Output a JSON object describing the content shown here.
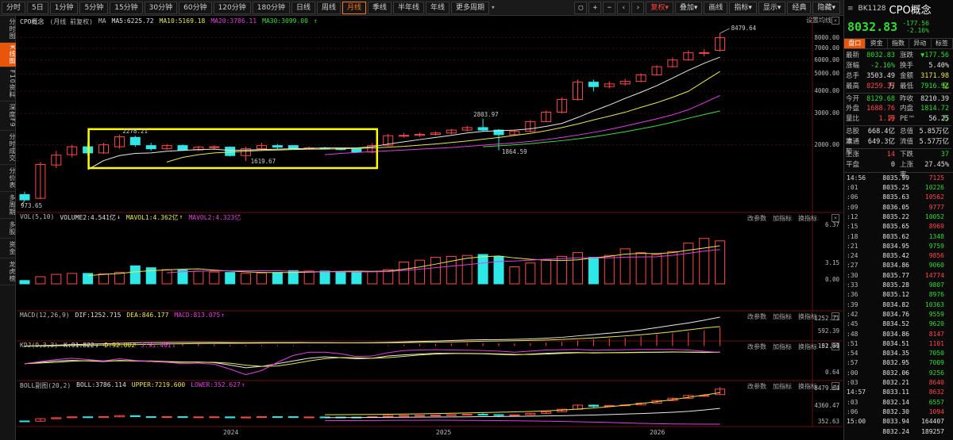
{
  "toolbar": {
    "periods": [
      {
        "label": "分时",
        "active": false
      },
      {
        "label": "5日",
        "active": false
      },
      {
        "label": "1分钟",
        "active": false
      },
      {
        "label": "5分钟",
        "active": false
      },
      {
        "label": "15分钟",
        "active": false
      },
      {
        "label": "30分钟",
        "active": false
      },
      {
        "label": "60分钟",
        "active": false
      },
      {
        "label": "120分钟",
        "active": false
      },
      {
        "label": "180分钟",
        "active": false
      },
      {
        "label": "日线",
        "active": false
      },
      {
        "label": "周线",
        "active": false
      },
      {
        "label": "月线",
        "active": true
      },
      {
        "label": "季线",
        "active": false
      },
      {
        "label": "半年线",
        "active": false
      },
      {
        "label": "年线",
        "active": false
      },
      {
        "label": "更多周期",
        "active": false
      }
    ],
    "more_arrow": "▾",
    "icons": [
      {
        "name": "window-icon",
        "glyph": "▢"
      },
      {
        "name": "zoom-in-icon",
        "glyph": "+"
      },
      {
        "name": "zoom-out-icon",
        "glyph": "−"
      },
      {
        "name": "chevron-left-icon",
        "glyph": "‹"
      },
      {
        "name": "chevron-right-icon",
        "glyph": "›"
      }
    ],
    "menus": [
      {
        "label": "复权▾",
        "red": true
      },
      {
        "label": "叠加▾",
        "red": false
      },
      {
        "label": "画线",
        "red": false
      },
      {
        "label": "指标▾",
        "red": false
      },
      {
        "label": "显示▾",
        "red": false
      },
      {
        "label": "经典",
        "red": false
      },
      {
        "label": "隐藏▾",
        "red": false
      }
    ]
  },
  "left_tabs": [
    {
      "label": "分时图",
      "active": false
    },
    {
      "label": "K线图",
      "active": true
    },
    {
      "label": "F10资料",
      "active": false
    },
    {
      "label": "深度F9",
      "active": false
    },
    {
      "label": "分时成交",
      "active": false
    },
    {
      "label": "分价表",
      "active": false
    },
    {
      "label": "多周期",
      "active": false
    },
    {
      "label": "多股",
      "active": false
    },
    {
      "label": "资金",
      "active": false
    },
    {
      "label": "龙虎榜",
      "active": false
    }
  ],
  "main": {
    "title": "CPO概念",
    "subtitle": "(月线 前复权)",
    "ma_label": "MA",
    "ma5": "MA5:6225.72",
    "ma10": "MA10:5169.18",
    "ma20": "MA20:3786.11",
    "ma30": "MA30:3099.00",
    "arrow_up": "↑",
    "settings": "设置均线",
    "y_ticks": [
      "8000.00",
      "7000.00",
      "6000.00",
      "5000.00",
      "4000.00",
      "3000.00",
      "2000.00"
    ],
    "annotations": {
      "high": "8479.64",
      "low": "973.65",
      "peak_2024": "2278.21",
      "trough_2024": "1619.67",
      "peak_2025": "2803.97",
      "trough_2025": "1864.59"
    }
  },
  "vol_panel": {
    "name": "VOL(5,10)",
    "vol": "VOLUME2:4.541亿",
    "ma1": "MAVOL1:4.362亿",
    "ma2": "MAVOL2:4.323亿",
    "down_arrow": "↓",
    "up_arrow": "↑",
    "y_ticks": [
      "6.37",
      "3.15",
      "0.00"
    ]
  },
  "macd_panel": {
    "name": "MACD(12,26,9)",
    "dif": "DIF:1252.715",
    "dea": "DEA:846.177",
    "macd": "MACD:813.075",
    "up_arrow": "↑",
    "y_ticks": [
      "1252.71",
      "592.39",
      "-51.01"
    ]
  },
  "kdj_panel": {
    "name": "KDJ(9,3,3)",
    "k": "K:91.822",
    "d": "D:92.002",
    "j": "J:91.461",
    "down_arrow": "↓",
    "y_ticks": [
      "102.99",
      "0.64"
    ]
  },
  "boll_panel": {
    "name": "BOLL副图(20,2)",
    "boll": "BOLL:3786.114",
    "upper": "UPPER:7219.600",
    "lower": "LOWER:352.627",
    "up_arrow": "↑",
    "y_ticks": [
      "8479.64",
      "4360.47",
      "352.63"
    ]
  },
  "panel_tools": [
    "改参数",
    "加指标",
    "换指标"
  ],
  "close_glyph": "×",
  "x_labels": [
    "2024",
    "2025",
    "2026"
  ],
  "quote": {
    "code": "BK1128",
    "name": "CPO概念",
    "price": "8032.83",
    "change": "-177.56",
    "change_pct": "-2.16%",
    "tabs": [
      {
        "label": "盘口",
        "active": true
      },
      {
        "label": "资金",
        "active": false
      },
      {
        "label": "指数",
        "active": false
      },
      {
        "label": "异动",
        "active": false
      },
      {
        "label": "标签",
        "active": false
      }
    ],
    "rows": [
      {
        "k": "最新",
        "v": "8032.83",
        "vc": "g",
        "k2": "涨跌",
        "v2": "▼177.56",
        "v2c": "g"
      },
      {
        "k": "涨幅",
        "v": "-2.16%",
        "vc": "g",
        "k2": "换手",
        "v2": "5.40%",
        "v2c": "w"
      },
      {
        "k": "总手",
        "v": "3503.49万",
        "vc": "w",
        "k2": "金额",
        "v2": "3171.98亿",
        "v2c": "y"
      },
      {
        "k": "最高",
        "v": "8259.37",
        "vc": "r",
        "k2": "最低",
        "v2": "7916.92",
        "v2c": "g"
      },
      {
        "k": "今开",
        "v": "8129.68",
        "vc": "g",
        "k2": "昨收",
        "v2": "8210.39",
        "v2c": "w"
      },
      {
        "k": "外盘",
        "v": "1688.76万",
        "vc": "r",
        "k2": "内盘",
        "v2": "1814.72万",
        "v2c": "g"
      },
      {
        "k": "量比",
        "v": "1.10",
        "vc": "r",
        "k2": "PE™",
        "v2": "56.25",
        "v2c": "w"
      },
      {
        "k": "总股本",
        "v": "668.4亿",
        "vc": "w",
        "k2": "总值",
        "v2": "5.85万亿",
        "v2c": "w"
      },
      {
        "k": "流通股",
        "v": "649.3亿",
        "vc": "w",
        "k2": "流值",
        "v2": "5.57万亿",
        "v2c": "w"
      },
      {
        "k": "上涨",
        "v": "14",
        "vc": "r",
        "k2": "下跌",
        "v2": "37",
        "v2c": "g"
      },
      {
        "k": "平盘",
        "v": "0",
        "vc": "w",
        "k2": "上涨率",
        "v2": "27.45%",
        "v2c": "w"
      }
    ],
    "ticks": [
      {
        "t": "14:56",
        "p": "8035.99",
        "v": "7125",
        "c": "r"
      },
      {
        "t": ":01",
        "p": "8035.25",
        "v": "10226",
        "c": "g"
      },
      {
        "t": ":06",
        "p": "8035.63",
        "v": "10562",
        "c": "r"
      },
      {
        "t": ":09",
        "p": "8036.05",
        "v": "9777",
        "c": "r"
      },
      {
        "t": ":12",
        "p": "8035.22",
        "v": "10052",
        "c": "g"
      },
      {
        "t": ":15",
        "p": "8035.65",
        "v": "8969",
        "c": "r"
      },
      {
        "t": ":18",
        "p": "8035.62",
        "v": "1348",
        "c": "g"
      },
      {
        "t": ":21",
        "p": "8034.95",
        "v": "9759",
        "c": "g"
      },
      {
        "t": ":24",
        "p": "8035.42",
        "v": "9856",
        "c": "r"
      },
      {
        "t": ":27",
        "p": "8034.86",
        "v": "9060",
        "c": "g"
      },
      {
        "t": ":30",
        "p": "8035.77",
        "v": "14774",
        "c": "r"
      },
      {
        "t": ":33",
        "p": "8035.28",
        "v": "9807",
        "c": "g"
      },
      {
        "t": ":36",
        "p": "8035.12",
        "v": "8976",
        "c": "g"
      },
      {
        "t": ":39",
        "p": "8034.82",
        "v": "10363",
        "c": "g"
      },
      {
        "t": ":42",
        "p": "8034.76",
        "v": "9559",
        "c": "g"
      },
      {
        "t": ":45",
        "p": "8034.52",
        "v": "9620",
        "c": "g"
      },
      {
        "t": ":48",
        "p": "8034.86",
        "v": "8147",
        "c": "r"
      },
      {
        "t": ":51",
        "p": "8034.51",
        "v": "1101",
        "c": "r"
      },
      {
        "t": ":54",
        "p": "8034.35",
        "v": "7050",
        "c": "g"
      },
      {
        "t": ":57",
        "p": "8032.95",
        "v": "7009",
        "c": "g"
      },
      {
        "t": ":00",
        "p": "8032.06",
        "v": "9256",
        "c": "g"
      },
      {
        "t": ":03",
        "p": "8032.21",
        "v": "8640",
        "c": "r"
      },
      {
        "t": "14:57",
        "p": "8033.11",
        "v": "8632",
        "c": "r"
      },
      {
        "t": ":03",
        "p": "8032.14",
        "v": "6557",
        "c": "g"
      },
      {
        "t": ":06",
        "p": "8032.30",
        "v": "1094",
        "c": "r"
      },
      {
        "t": "15:00",
        "p": "8033.94",
        "v": "164407",
        "c": "w"
      },
      {
        "t": "",
        "p": "8032.24",
        "v": "189257",
        "c": "w"
      }
    ]
  },
  "colors": {
    "up": "#ff4848",
    "down": "#2ee8e8",
    "ma5": "#e8e8e8",
    "ma10": "#e8e84a",
    "ma20": "#e040e0",
    "ma30": "#3cdc3c",
    "accent": "#e8560c",
    "highlight_box": "#ffff00"
  },
  "chart_data": {
    "type": "candlestick",
    "period": "monthly",
    "x_labels": [
      "2024",
      "2025",
      "2026"
    ],
    "ylim": [
      800,
      8800
    ],
    "candles": [
      {
        "o": 1050,
        "c": 980,
        "h": 1090,
        "l": 973.65
      },
      {
        "o": 1000,
        "c": 1550,
        "h": 1600,
        "l": 990
      },
      {
        "o": 1540,
        "c": 1750,
        "h": 1850,
        "l": 1480
      },
      {
        "o": 1760,
        "c": 1950,
        "h": 2000,
        "l": 1700
      },
      {
        "o": 1950,
        "c": 1800,
        "h": 2050,
        "l": 1750
      },
      {
        "o": 1800,
        "c": 2000,
        "h": 2050,
        "l": 1780
      },
      {
        "o": 1950,
        "c": 2220,
        "h": 2278.21,
        "l": 1900
      },
      {
        "o": 2200,
        "c": 2000,
        "h": 2250,
        "l": 1950
      },
      {
        "o": 1980,
        "c": 1900,
        "h": 2050,
        "l": 1850
      },
      {
        "o": 1900,
        "c": 1980,
        "h": 2020,
        "l": 1870
      },
      {
        "o": 1980,
        "c": 1870,
        "h": 2010,
        "l": 1850
      },
      {
        "o": 1870,
        "c": 1940,
        "h": 1980,
        "l": 1850
      },
      {
        "o": 1940,
        "c": 1950,
        "h": 1990,
        "l": 1900
      },
      {
        "o": 1940,
        "c": 1740,
        "h": 1960,
        "l": 1720
      },
      {
        "o": 1740,
        "c": 1900,
        "h": 1950,
        "l": 1619.67
      },
      {
        "o": 1900,
        "c": 1980,
        "h": 2050,
        "l": 1860
      },
      {
        "o": 1980,
        "c": 1940,
        "h": 2020,
        "l": 1900
      },
      {
        "o": 1980,
        "c": 1900,
        "h": 1990,
        "l": 1880
      },
      {
        "o": 1900,
        "c": 1920,
        "h": 1960,
        "l": 1880
      },
      {
        "o": 1920,
        "c": 1900,
        "h": 1950,
        "l": 1880
      },
      {
        "o": 1900,
        "c": 1880,
        "h": 1920,
        "l": 1860
      },
      {
        "o": 1890,
        "c": 1820,
        "h": 1910,
        "l": 1800
      },
      {
        "o": 1820,
        "c": 1980,
        "h": 2040,
        "l": 1790
      },
      {
        "o": 1990,
        "c": 2250,
        "h": 2300,
        "l": 1960
      },
      {
        "o": 2250,
        "c": 2260,
        "h": 2340,
        "l": 2200
      },
      {
        "o": 2260,
        "c": 2290,
        "h": 2340,
        "l": 2220
      },
      {
        "o": 2290,
        "c": 2330,
        "h": 2380,
        "l": 2250
      },
      {
        "o": 2330,
        "c": 2420,
        "h": 2460,
        "l": 2290
      },
      {
        "o": 2420,
        "c": 2500,
        "h": 2560,
        "l": 2380
      },
      {
        "o": 2500,
        "c": 2420,
        "h": 2803.97,
        "l": 2380
      },
      {
        "o": 2420,
        "c": 2280,
        "h": 2450,
        "l": 1864.59
      },
      {
        "o": 2280,
        "c": 2380,
        "h": 2430,
        "l": 2250
      },
      {
        "o": 2380,
        "c": 2700,
        "h": 2760,
        "l": 2350
      },
      {
        "o": 2700,
        "c": 3050,
        "h": 3120,
        "l": 2680
      },
      {
        "o": 3050,
        "c": 3600,
        "h": 3700,
        "l": 3000
      },
      {
        "o": 3600,
        "c": 4500,
        "h": 4650,
        "l": 3550
      },
      {
        "o": 4500,
        "c": 4250,
        "h": 4650,
        "l": 4000
      },
      {
        "o": 4250,
        "c": 4400,
        "h": 4550,
        "l": 4150
      },
      {
        "o": 4400,
        "c": 4550,
        "h": 4700,
        "l": 4300
      },
      {
        "o": 4550,
        "c": 4950,
        "h": 5050,
        "l": 4500
      },
      {
        "o": 4950,
        "c": 5500,
        "h": 5600,
        "l": 4900
      },
      {
        "o": 5500,
        "c": 6000,
        "h": 6200,
        "l": 5450
      },
      {
        "o": 6000,
        "c": 6600,
        "h": 6800,
        "l": 5950
      },
      {
        "o": 6600,
        "c": 6600,
        "h": 6900,
        "l": 6300
      },
      {
        "o": 6800,
        "c": 8000,
        "h": 8479.64,
        "l": 6700
      }
    ],
    "ma5_y": [
      null,
      null,
      null,
      null,
      1450,
      1630,
      1740,
      1790,
      1800,
      1840,
      1860,
      1880,
      1890,
      1860,
      1870,
      1880,
      1890,
      1900,
      1910,
      1920,
      1920,
      1920,
      1950,
      2020,
      2080,
      2140,
      2200,
      2260,
      2330,
      2380,
      2400,
      2420,
      2460,
      2540,
      2640,
      2850,
      3100,
      3350,
      3650,
      3950,
      4300,
      4750,
      5250,
      5750,
      6225.72
    ],
    "ma10_y": [
      null,
      null,
      null,
      null,
      null,
      null,
      null,
      null,
      null,
      1600,
      1700,
      1760,
      1800,
      1820,
      1840,
      1860,
      1870,
      1880,
      1890,
      1890,
      1900,
      1910,
      1920,
      1940,
      1960,
      1990,
      2020,
      2060,
      2100,
      2150,
      2200,
      2260,
      2320,
      2400,
      2500,
      2620,
      2760,
      2900,
      3050,
      3250,
      3450,
      3700,
      4000,
      4550,
      5169.18
    ],
    "ma20_y": [
      null,
      null,
      null,
      null,
      null,
      null,
      null,
      null,
      null,
      null,
      null,
      null,
      null,
      null,
      null,
      null,
      null,
      null,
      null,
      1760,
      1790,
      1810,
      1830,
      1850,
      1870,
      1890,
      1910,
      1930,
      1960,
      1990,
      2020,
      2050,
      2090,
      2140,
      2200,
      2270,
      2350,
      2440,
      2550,
      2670,
      2800,
      2950,
      3150,
      3450,
      3786.11
    ],
    "ma30_y": [
      null,
      null,
      null,
      null,
      null,
      null,
      null,
      null,
      null,
      null,
      null,
      null,
      null,
      null,
      null,
      null,
      null,
      null,
      null,
      null,
      null,
      null,
      null,
      null,
      null,
      null,
      null,
      null,
      null,
      1950,
      1975,
      2000,
      2030,
      2070,
      2110,
      2160,
      2220,
      2290,
      2370,
      2460,
      2560,
      2680,
      2820,
      2960,
      3099.0
    ],
    "volume": [
      0.35,
      0.75,
      1.0,
      1.1,
      1.1,
      1.05,
      1.2,
      1.9,
      1.7,
      1.5,
      1.45,
      1.35,
      1.25,
      1.2,
      1.1,
      1.15,
      1.2,
      1.4,
      1.35,
      1.35,
      1.3,
      1.3,
      1.3,
      1.5,
      2.3,
      2.5,
      2.8,
      2.9,
      3.0,
      3.1,
      2.9,
      1.8,
      2.2,
      2.5,
      2.9,
      3.3,
      2.8,
      3.0,
      3.7,
      3.3,
      3.1,
      3.4,
      4.3,
      4.8,
      4.541
    ],
    "macd_dif": [
      0,
      20,
      40,
      60,
      80,
      100,
      120,
      140,
      150,
      155,
      160,
      160,
      158,
      150,
      148,
      150,
      152,
      150,
      148,
      145,
      142,
      140,
      145,
      160,
      180,
      200,
      220,
      240,
      260,
      275,
      280,
      290,
      310,
      340,
      380,
      440,
      500,
      560,
      620,
      700,
      800,
      900,
      1000,
      1120,
      1252.715
    ],
    "macd_dea": [
      0,
      5,
      15,
      25,
      35,
      45,
      55,
      65,
      75,
      90,
      100,
      110,
      118,
      122,
      126,
      130,
      133,
      135,
      137,
      138,
      138,
      138,
      139,
      143,
      150,
      160,
      170,
      180,
      195,
      210,
      220,
      232,
      246,
      264,
      287,
      318,
      354,
      395,
      440,
      490,
      550,
      620,
      700,
      780,
      846.177
    ],
    "kdj_k": [
      50,
      55,
      60,
      62,
      60,
      58,
      62,
      60,
      58,
      56,
      55,
      56,
      54,
      45,
      35,
      40,
      50,
      60,
      70,
      75,
      72,
      68,
      70,
      78,
      82,
      85,
      88,
      88,
      87,
      86,
      84,
      82,
      85,
      88,
      90,
      91,
      89,
      90,
      91,
      92,
      92,
      93,
      92,
      91,
      91.822
    ],
    "kdj_j": [
      50,
      58,
      65,
      70,
      65,
      60,
      68,
      62,
      58,
      55,
      50,
      52,
      48,
      30,
      10,
      25,
      55,
      80,
      92,
      92,
      86,
      76,
      78,
      90,
      98,
      100,
      101,
      100,
      99,
      98,
      96,
      92,
      96,
      100,
      101,
      102,
      99,
      100,
      101,
      102,
      102,
      102,
      100,
      95,
      91.461
    ],
    "boll_upper": [
      null,
      null,
      null,
      null,
      null,
      null,
      null,
      null,
      null,
      null,
      null,
      null,
      null,
      null,
      null,
      null,
      null,
      null,
      null,
      2400,
      2430,
      2460,
      2480,
      2520,
      2560,
      2610,
      2660,
      2720,
      2800,
      2880,
      2950,
      3030,
      3120,
      3250,
      3420,
      3640,
      3880,
      4150,
      4480,
      4850,
      5250,
      5700,
      6200,
      6700,
      7219.6
    ],
    "boll_mid": [
      null,
      null,
      null,
      null,
      null,
      null,
      null,
      null,
      null,
      null,
      null,
      null,
      null,
      null,
      null,
      null,
      null,
      null,
      null,
      1760,
      1790,
      1810,
      1830,
      1850,
      1870,
      1890,
      1910,
      1930,
      1960,
      1990,
      2020,
      2050,
      2090,
      2140,
      2200,
      2270,
      2350,
      2440,
      2550,
      2670,
      2800,
      2950,
      3150,
      3450,
      3786.114
    ],
    "boll_lower": [
      null,
      null,
      null,
      null,
      null,
      null,
      null,
      null,
      null,
      null,
      null,
      null,
      null,
      null,
      null,
      null,
      null,
      null,
      null,
      1100,
      1120,
      1140,
      1160,
      1180,
      1190,
      1200,
      1210,
      1200,
      1180,
      1150,
      1120,
      1080,
      1050,
      1000,
      950,
      880,
      800,
      720,
      620,
      520,
      450,
      400,
      380,
      360,
      352.627
    ]
  }
}
